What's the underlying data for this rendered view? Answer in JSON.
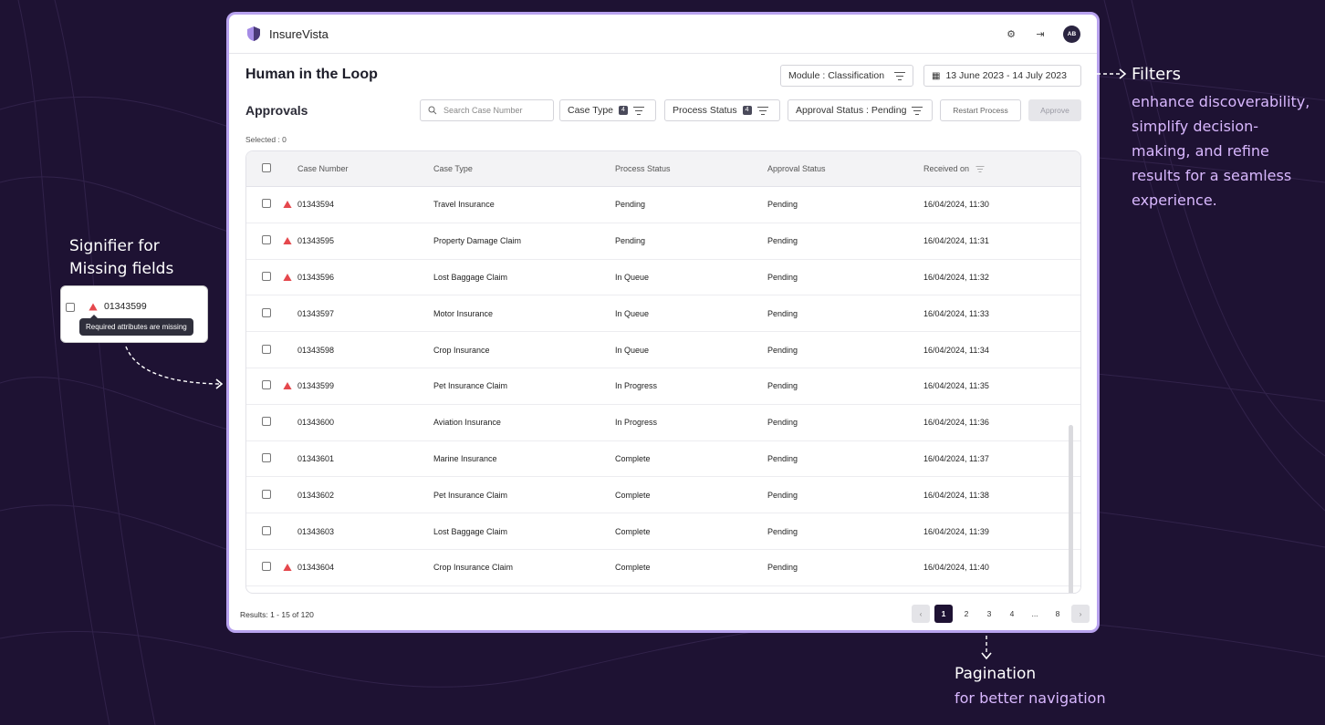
{
  "app": {
    "name": "InsureVista",
    "avatar_initials": "AB"
  },
  "topbar": {
    "settings_icon": "gear-icon",
    "logout_icon": "logout-icon"
  },
  "page": {
    "title": "Human in the Loop"
  },
  "filters": {
    "module": "Module : Classification",
    "date_range": "13 June 2023 - 14 July 2023",
    "search_placeholder": "Search Case Number",
    "case_type": {
      "label": "Case Type",
      "count": "4"
    },
    "process_status": {
      "label": "Process Status",
      "count": "4"
    },
    "approval_status": "Approval Status : Pending",
    "restart_button": "Restart Process",
    "approve_button": "Approve"
  },
  "section": {
    "title": "Approvals",
    "selected": "Selected : 0"
  },
  "table": {
    "headers": [
      "Case Number",
      "Case Type",
      "Process Status",
      "Approval Status",
      "Received on"
    ],
    "rows": [
      {
        "case": "01343594",
        "type": "Travel Insurance",
        "process": "Pending",
        "approval": "Pending",
        "received": "16/04/2024, 11:30",
        "warning": true
      },
      {
        "case": "01343595",
        "type": "Property Damage Claim",
        "process": "Pending",
        "approval": "Pending",
        "received": "16/04/2024, 11:31",
        "warning": true
      },
      {
        "case": "01343596",
        "type": "Lost Baggage Claim",
        "process": "In Queue",
        "approval": "Pending",
        "received": "16/04/2024, 11:32",
        "warning": true
      },
      {
        "case": "01343597",
        "type": "Motor Insurance",
        "process": "In Queue",
        "approval": "Pending",
        "received": "16/04/2024, 11:33",
        "warning": false
      },
      {
        "case": "01343598",
        "type": "Crop Insurance",
        "process": "In Queue",
        "approval": "Pending",
        "received": "16/04/2024, 11:34",
        "warning": false
      },
      {
        "case": "01343599",
        "type": "Pet Insurance Claim",
        "process": "In Progress",
        "approval": "Pending",
        "received": "16/04/2024, 11:35",
        "warning": true
      },
      {
        "case": "01343600",
        "type": "Aviation Insurance",
        "process": "In Progress",
        "approval": "Pending",
        "received": "16/04/2024, 11:36",
        "warning": false
      },
      {
        "case": "01343601",
        "type": "Marine Insurance",
        "process": "Complete",
        "approval": "Pending",
        "received": "16/04/2024, 11:37",
        "warning": false
      },
      {
        "case": "01343602",
        "type": "Pet Insurance Claim",
        "process": "Complete",
        "approval": "Pending",
        "received": "16/04/2024, 11:38",
        "warning": false
      },
      {
        "case": "01343603",
        "type": "Lost Baggage Claim",
        "process": "Complete",
        "approval": "Pending",
        "received": "16/04/2024, 11:39",
        "warning": false
      },
      {
        "case": "01343604",
        "type": "Crop Insurance Claim",
        "process": "Complete",
        "approval": "Pending",
        "received": "16/04/2024, 11:40",
        "warning": true
      }
    ]
  },
  "footer": {
    "results": "Results: 1 - 15 of 120",
    "pages": [
      "1",
      "2",
      "3",
      "4",
      "...",
      "8"
    ],
    "prev": "‹",
    "next": "›"
  },
  "annotations": {
    "filters_title": "Filters",
    "filters_body": "enhance discoverability, simplify decision-making, and refine results for a seamless experience.",
    "missing_title": "Signifier for Missing fields",
    "missing_case": "01343599",
    "missing_tooltip": "Required attributes are missing",
    "pagination_title": "Pagination",
    "pagination_body": "for better navigation"
  },
  "colors": {
    "background": "#1e1233",
    "accent": "#b8a2ef",
    "warning": "#e5484d"
  }
}
